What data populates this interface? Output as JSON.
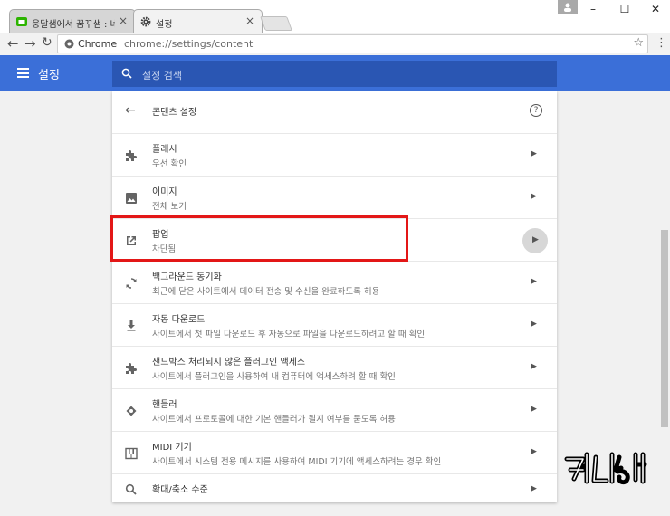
{
  "browser": {
    "tabs": [
      {
        "title": "웅달샘에서 꿈꾸샘 : 네이",
        "icon": "naver-blog-icon"
      },
      {
        "title": "설정",
        "icon": "gear-icon"
      }
    ],
    "omnibox": {
      "site": "Chrome",
      "url": "chrome://settings/content"
    }
  },
  "header": {
    "title": "설정",
    "search_placeholder": "설정 검색"
  },
  "content": {
    "title": "콘텐츠 설정",
    "rows": [
      {
        "title": "플래시",
        "subtitle": "우선 확인",
        "icon": "puzzle-icon"
      },
      {
        "title": "이미지",
        "subtitle": "전체 보기",
        "icon": "image-icon"
      },
      {
        "title": "팝업",
        "subtitle": "차단됨",
        "icon": "open-in-new-icon"
      },
      {
        "title": "백그라운드 동기화",
        "subtitle": "최근에 닫은 사이트에서 데이터 전송 및 수신을 완료하도록 허용",
        "icon": "sync-icon"
      },
      {
        "title": "자동 다운로드",
        "subtitle": "사이트에서 첫 파일 다운로드 후 자동으로 파일을 다운로드하려고 할 때 확인",
        "icon": "download-icon"
      },
      {
        "title": "샌드박스 처리되지 않은 플러그인 액세스",
        "subtitle": "사이트에서 플러그인을 사용하여 내 컴퓨터에 액세스하려 할 때 확인",
        "icon": "puzzle-icon"
      },
      {
        "title": "핸들러",
        "subtitle": "사이트에서 프로토콜에 대한 기본 핸들러가 될지 여부를 묻도록 허용",
        "icon": "handler-icon"
      },
      {
        "title": "MIDI 기기",
        "subtitle": "사이트에서 시스템 전용 메시지를 사용하여 MIDI 기기에 액세스하려는 경우 확인",
        "icon": "piano-icon"
      },
      {
        "title": "확대/축소 수준",
        "subtitle": "",
        "icon": "zoom-icon"
      }
    ]
  },
  "watermark": {
    "text": "처니샘"
  },
  "colors": {
    "header": "#3b6fd8",
    "search": "#2a56b3",
    "highlight": "#e31717"
  }
}
